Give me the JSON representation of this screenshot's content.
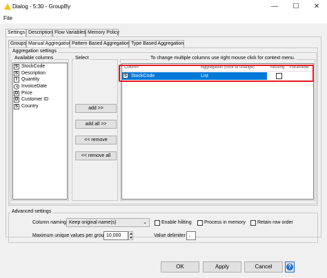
{
  "window": {
    "title": "Dialog - 5:30 - GroupBy",
    "menu_file": "File",
    "minimize_glyph": "—",
    "maximize_glyph": "☐",
    "close_glyph": "✕"
  },
  "outer_tabs": [
    "Settings",
    "Description",
    "Flow Variables",
    "Memory Policy"
  ],
  "inner_tabs": [
    "Groups",
    "Manual Aggregation",
    "Pattern Based Aggregation",
    "Type Based Aggregation"
  ],
  "aggregation_settings": {
    "group_label": "Aggregation settings",
    "available_columns_label": "Available columns",
    "columns": [
      {
        "type": "S",
        "name": "StockCode"
      },
      {
        "type": "S",
        "name": "Description"
      },
      {
        "type": "I",
        "name": "Quantity"
      },
      {
        "type": "clock",
        "name": "InvoiceDate"
      },
      {
        "type": "D",
        "name": "Price"
      },
      {
        "type": "D",
        "name": "Customer ID"
      },
      {
        "type": "S",
        "name": "Country"
      }
    ],
    "select_label": "Select",
    "buttons": {
      "add": "add >>",
      "add_all": "add all >>",
      "remove": "<< remove",
      "remove_all": "<< remove all"
    },
    "hint": "To change multiple columns use right mouse click for context menu.",
    "table": {
      "headers": [
        "Column",
        "Aggregation (click to change)",
        "Missing",
        "Parameter"
      ],
      "rows": [
        {
          "type": "S",
          "column": "StockCode",
          "aggregation": "List",
          "missing": false,
          "parameter": ""
        }
      ]
    }
  },
  "advanced_settings": {
    "group_label": "Advanced settings",
    "column_naming_label": "Column naming:",
    "column_naming_value": "Keep original name(s)",
    "enable_hiliting": "Enable hiliting",
    "process_in_memory": "Process in memory",
    "retain_row_order": "Retain row order",
    "max_unique_label": "Maximum unique values per group",
    "max_unique_value": "10,000",
    "value_delimiter_label": "Value delimiter",
    "value_delimiter_value": ","
  },
  "footer": {
    "ok": "OK",
    "apply": "Apply",
    "cancel": "Cancel",
    "help": "?"
  },
  "colors": {
    "selection": "#0078d7",
    "highlight_box": "#e8141c",
    "help_icon": "#1e6fd0"
  }
}
